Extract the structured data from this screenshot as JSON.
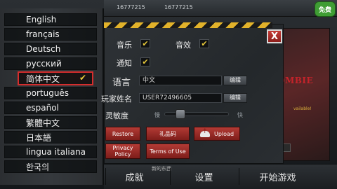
{
  "header": {
    "stat1": "16777215",
    "stat2": "16777215",
    "free_badge": "免费"
  },
  "languages": [
    {
      "label": "English",
      "selected": false
    },
    {
      "label": "français",
      "selected": false
    },
    {
      "label": "Deutsch",
      "selected": false
    },
    {
      "label": "русский",
      "selected": false
    },
    {
      "label": "简体中文",
      "selected": true
    },
    {
      "label": "português",
      "selected": false
    },
    {
      "label": "español",
      "selected": false
    },
    {
      "label": "繁體中文",
      "selected": false
    },
    {
      "label": "日本語",
      "selected": false
    },
    {
      "label": "lingua italiana",
      "selected": false
    },
    {
      "label": "한국의",
      "selected": false
    }
  ],
  "settings": {
    "close_label": "X",
    "music_label": "音乐",
    "music_checked": true,
    "sound_label": "音效",
    "sound_checked": true,
    "notify_label": "通知",
    "notify_checked": true,
    "language_label": "语言",
    "language_value": "中文",
    "player_name_label": "玩家姓名",
    "player_name_value": "USER72496605",
    "edit_label": "编辑",
    "sensitivity_label": "灵敏度",
    "sensitivity_slow": "慢",
    "sensitivity_fast": "快",
    "sensitivity_level": 0.2,
    "restore_label": "Restore",
    "gift_code_label": "礼品码",
    "upload_label": "Upload",
    "privacy_label": "Privacy Policy",
    "terms_label": "Terms of Use"
  },
  "bottom": {
    "achievements_label": "成就",
    "new_tag": "新的东西",
    "settings_label": "设置",
    "start_label": "开始游戏"
  },
  "poster": {
    "title": "OMBIE",
    "subtitle": "vailable!"
  }
}
